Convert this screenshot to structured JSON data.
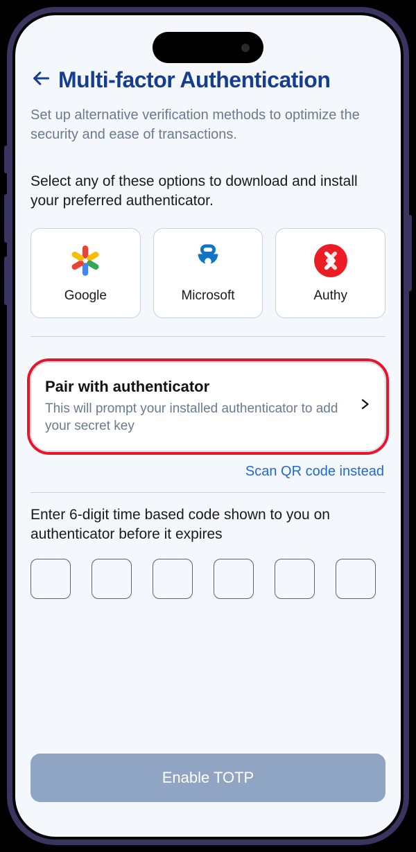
{
  "header": {
    "title": "Multi-factor Authentication",
    "subtitle": "Set up alternative verification methods to optimize the security and ease of transactions."
  },
  "apps": {
    "prompt": "Select any of these options to download and install your preferred authenticator.",
    "items": [
      {
        "name": "Google"
      },
      {
        "name": "Microsoft"
      },
      {
        "name": "Authy"
      }
    ]
  },
  "pair": {
    "title": "Pair with authenticator",
    "desc": "This will prompt your installed authenticator to add your secret key"
  },
  "qr_link": "Scan QR code instead",
  "code": {
    "prompt": "Enter 6-digit time based code shown to you on authenticator before it expires",
    "length": 6
  },
  "enable_button": "Enable TOTP"
}
